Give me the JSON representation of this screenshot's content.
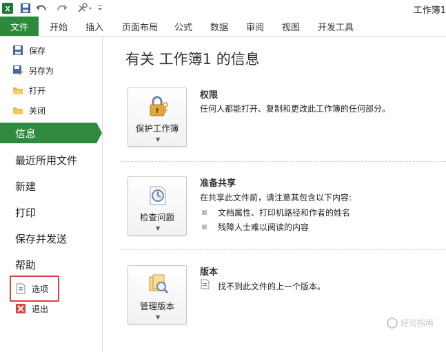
{
  "window": {
    "title": "工作簿1"
  },
  "ribbon": {
    "file_tab": "文件",
    "tabs": [
      "开始",
      "插入",
      "页面布局",
      "公式",
      "数据",
      "审阅",
      "视图",
      "开发工具"
    ]
  },
  "sidebar": {
    "small_items_top": [
      "保存",
      "另存为",
      "打开",
      "关闭"
    ],
    "big_items": [
      "信息",
      "最近所用文件",
      "新建",
      "打印",
      "保存并发送",
      "帮助"
    ],
    "active_item": "信息",
    "small_items_bottom": [
      "选项",
      "退出"
    ]
  },
  "main": {
    "heading": "有关 工作簿1 的信息",
    "sections": [
      {
        "button": "保护工作簿",
        "title": "权限",
        "text": "任何人都能打开、复制和更改此工作簿的任何部分。"
      },
      {
        "button": "检查问题",
        "title": "准备共享",
        "text": "在共享此文件前，请注意其包含以下内容:",
        "bullets": [
          "文档属性、打印机路径和作者的姓名",
          "残障人士难以阅读的内容"
        ]
      },
      {
        "button": "管理版本",
        "title": "版本",
        "text": "找不到此文件的上一个版本。"
      }
    ]
  },
  "watermark": "经验指南",
  "colors": {
    "accent_green": "#2e8b3e",
    "highlight_red": "#e23b3b"
  }
}
